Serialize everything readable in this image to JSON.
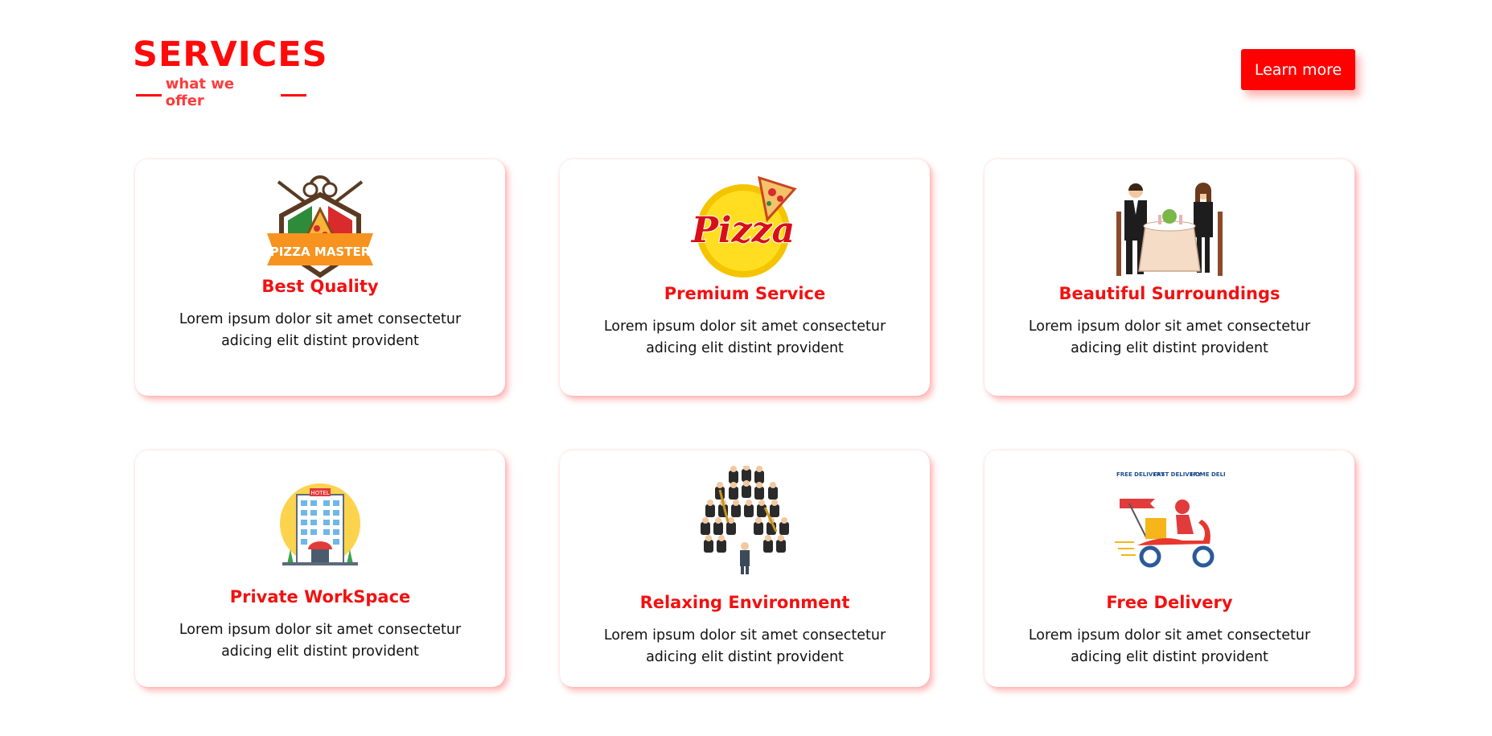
{
  "heading": {
    "title": "SERVICES",
    "subtitle": "what we offer"
  },
  "learn_more": {
    "label": "Learn more"
  },
  "colors": {
    "accent": "#ff0a0a",
    "card_shadow": "#ff6464"
  },
  "cards": [
    {
      "icon": "pizza-master-logo-icon",
      "title": "Best Quality",
      "desc": "Lorem ipsum dolor sit amet consectetur adicing elit distint provident"
    },
    {
      "icon": "pizza-logo-icon",
      "title": "Premium Service",
      "desc": "Lorem ipsum dolor sit amet consectetur adicing elit distint provident"
    },
    {
      "icon": "dining-couple-icon",
      "title": "Beautiful Surroundings",
      "desc": "Lorem ipsum dolor sit amet consectetur adicing elit distint provident"
    },
    {
      "icon": "hotel-building-icon",
      "title": "Private WorkSpace",
      "desc": "Lorem ipsum dolor sit amet consectetur adicing elit distint provident"
    },
    {
      "icon": "orchestra-icon",
      "title": "Relaxing Environment",
      "desc": "Lorem ipsum dolor sit amet consectetur adicing elit distint provident"
    },
    {
      "icon": "delivery-scooter-icon",
      "title": "Free Delivery",
      "desc": "Lorem ipsum dolor sit amet consectetur adicing elit distint provident",
      "badges": [
        "FREE DELIVERY",
        "FAST DELIVERY",
        "HOME DELIVERY"
      ]
    }
  ]
}
